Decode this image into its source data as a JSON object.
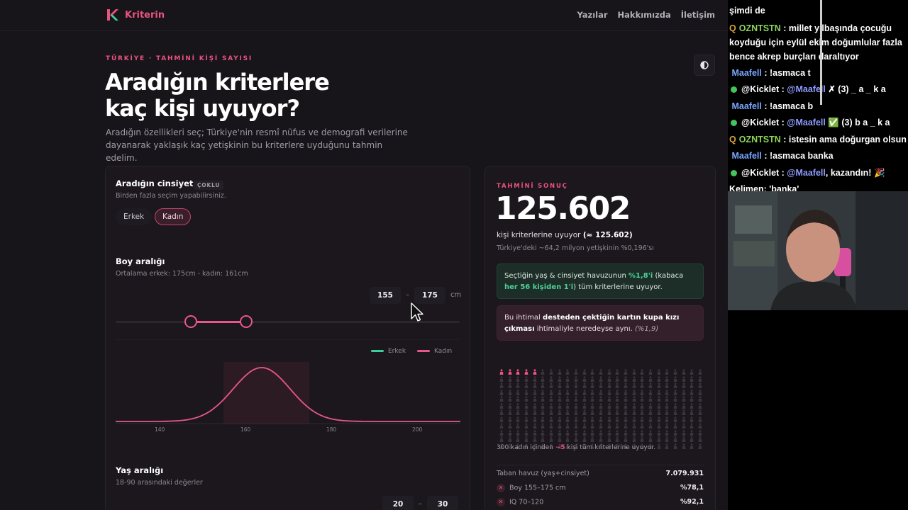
{
  "site": {
    "brand": "Kriterin",
    "nav": [
      "Yazılar",
      "Hakkımızda",
      "İletişim"
    ],
    "eyebrow": "TÜRKİYE · TAHMİNİ KİŞİ SAYISI",
    "title_line1": "Aradığın kriterlere",
    "title_line2": "kaç kişi uyuyor?",
    "subtitle": "Aradığın özellikleri seç; Türkiye'nin resmî nüfus ve demografi verilerine dayanarak yaklaşık kaç yetişkinin bu kriterlere uyduğunu tahmin edelim.",
    "theme_icon": "half-circle-icon"
  },
  "filters": {
    "gender": {
      "title": "Aradığın cinsiyet",
      "badge": "ÇOKLU",
      "note": "Birden fazla seçim yapabilirsiniz.",
      "options": [
        "Erkek",
        "Kadın"
      ],
      "selected": "Kadın"
    },
    "height": {
      "title": "Boy aralığı",
      "note": "Ortalama erkek: 175cm - kadın: 161cm",
      "min": "155",
      "max": "175",
      "dash": "–",
      "unit": "cm",
      "legend": [
        "Erkek",
        "Kadın"
      ],
      "ticks": [
        "140",
        "160",
        "180",
        "200"
      ]
    },
    "age": {
      "title": "Yaş aralığı",
      "note": "18-90 arasındaki değerler",
      "min": "20",
      "max": "30",
      "dash": "–"
    }
  },
  "result": {
    "eyebrow": "TAHMİNİ SONUÇ",
    "number": "125.602",
    "line_prefix": "kişi kriterlerine uyuyor",
    "line_approx": "(≈ 125.602)",
    "sub": "Türkiye'deki ~64,2 milyon yetişkinin %0,196'sı",
    "green_card": {
      "text1": "Seçtiğin yaş & cinsiyet havuzunun ",
      "pct": "%1,8'i",
      "text2": " (kabaca ",
      "ratio": "her 56 kişiden 1'i",
      "text3": ") tüm kriterlerine uyuyor."
    },
    "red_card": {
      "text1": "Bu ihtimal ",
      "strong": "desteden çektiğin kartın kupa kızı çıkması",
      "text2": " ihtimaliyle neredeyse aynı. ",
      "pct": "(%1,9)"
    },
    "people_total": 300,
    "people_highlighted": 5,
    "people_note_prefix": "300 kadın içinden ",
    "people_note_count": "~5",
    "people_note_suffix": " kişi tüm kriterlerine uyuyor.",
    "stats": [
      {
        "label": "Taban havuz (yaş+cinsiyet)",
        "value": "7.079.931",
        "icon": false
      },
      {
        "label": "Boy 155–175 cm",
        "value": "%78,1",
        "icon": true
      },
      {
        "label": "IQ 70–120",
        "value": "%92,1",
        "icon": true
      }
    ]
  },
  "chat": {
    "lines": [
      {
        "user": "",
        "text": "şimdi de"
      },
      {
        "user": "OZNTSTN",
        "text": "millet yılbaşında çocuğu koyduğu için eylül ekim doğumlular fazla bence akrep burçları daraltıyor"
      },
      {
        "user": "Maafell",
        "text": "!asmaca t"
      },
      {
        "user": "@Kicklet",
        "mention": "@Maafell",
        "text": "✗ (3) _ a _ k a"
      },
      {
        "user": "Maafell",
        "text": "!asmaca b"
      },
      {
        "user": "@Kicklet",
        "mention": "@Maafell",
        "text": "✅ (3) b a _ k a"
      },
      {
        "user": "OZNTSTN",
        "text": "istesin ama doğurgan olsun"
      },
      {
        "user": "Maafell",
        "text": "!asmaca banka"
      },
      {
        "user": "@Kicklet",
        "mention": "@Maafell",
        "text": ", kazandın! 🎉"
      },
      {
        "user": "",
        "text": "Kelimen: 'banka'"
      }
    ]
  },
  "colors": {
    "accent": "#e8537f",
    "male": "#3ccf9a",
    "female": "#e8578a",
    "background": "#17141a"
  }
}
